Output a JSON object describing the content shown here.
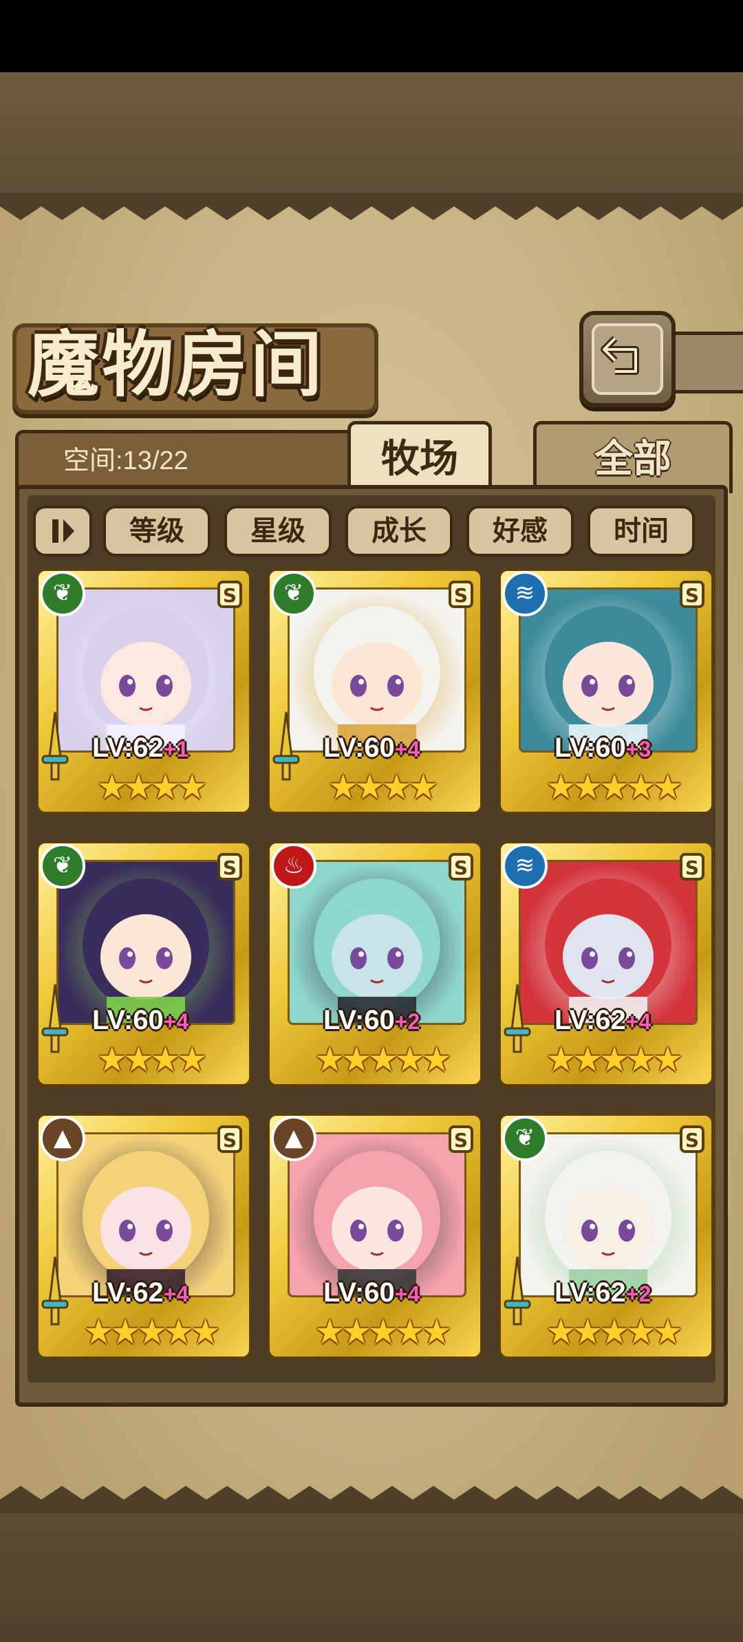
{
  "header": {
    "title": "魔物房间",
    "back_icon": "return-arrow-icon"
  },
  "room": {
    "capacity_text": "空间:13/22"
  },
  "tabs": [
    {
      "label": "牧场",
      "active": true
    },
    {
      "label": "全部",
      "active": false
    }
  ],
  "sort": {
    "toggle_label": "⏸",
    "buttons": [
      "等级",
      "星级",
      "成长",
      "好感",
      "时间"
    ]
  },
  "colors": {
    "nature": "#2f7d2a",
    "water": "#1e6fb0",
    "fire": "#c01818",
    "earth": "#6b4426"
  },
  "monsters": [
    {
      "element": "nature",
      "element_icon": "leaf-icon",
      "rank": "S",
      "level": "LV:62",
      "plus": "+1",
      "stars": "★★★★",
      "equipped": true,
      "hair": "#d8d0ec",
      "skin": "#fbe8de",
      "accent": "#f3f0ff"
    },
    {
      "element": "nature",
      "element_icon": "leaf-icon",
      "rank": "S",
      "level": "LV:60",
      "plus": "+4",
      "stars": "★★★★",
      "equipped": true,
      "hair": "#f4f2ec",
      "skin": "#fde6d4",
      "accent": "#d9a640"
    },
    {
      "element": "water",
      "element_icon": "water-wave-icon",
      "rank": "S",
      "level": "LV:60",
      "plus": "+3",
      "stars": "★★★★★",
      "equipped": false,
      "hair": "#3c8a9a",
      "skin": "#fde6dc",
      "accent": "#e8f4f8"
    },
    {
      "element": "nature",
      "element_icon": "leaf-icon",
      "rank": "S",
      "level": "LV:60",
      "plus": "+4",
      "stars": "★★★★",
      "equipped": true,
      "hair": "#3a2c5c",
      "skin": "#fbe6d8",
      "accent": "#7fd04a"
    },
    {
      "element": "fire",
      "element_icon": "flame-icon",
      "rank": "S",
      "level": "LV:60",
      "plus": "+2",
      "stars": "★★★★★",
      "equipped": false,
      "hair": "#8fd6cc",
      "skin": "#c8e4e8",
      "accent": "#2c2c34"
    },
    {
      "element": "water",
      "element_icon": "water-wave-icon",
      "rank": "S",
      "level": "LV:62",
      "plus": "+4",
      "stars": "★★★★★",
      "equipped": true,
      "hair": "#d4343c",
      "skin": "#dfe4ee",
      "accent": "#f0f0f0"
    },
    {
      "element": "earth",
      "element_icon": "mountain-icon",
      "rank": "S",
      "level": "LV:62",
      "plus": "+4",
      "stars": "★★★★★",
      "equipped": true,
      "hair": "#f3d27a",
      "skin": "#fbe2e4",
      "accent": "#3a2430"
    },
    {
      "element": "earth",
      "element_icon": "mountain-icon",
      "rank": "S",
      "level": "LV:60",
      "plus": "+4",
      "stars": "★★★★★",
      "equipped": false,
      "hair": "#f4a2ac",
      "skin": "#fde6e0",
      "accent": "#3a3a3a"
    },
    {
      "element": "nature",
      "element_icon": "leaf-icon",
      "rank": "S",
      "level": "LV:62",
      "plus": "+2",
      "stars": "★★★★★",
      "equipped": true,
      "hair": "#f2f2ee",
      "skin": "#f6efe6",
      "accent": "#9fd0a4"
    }
  ]
}
